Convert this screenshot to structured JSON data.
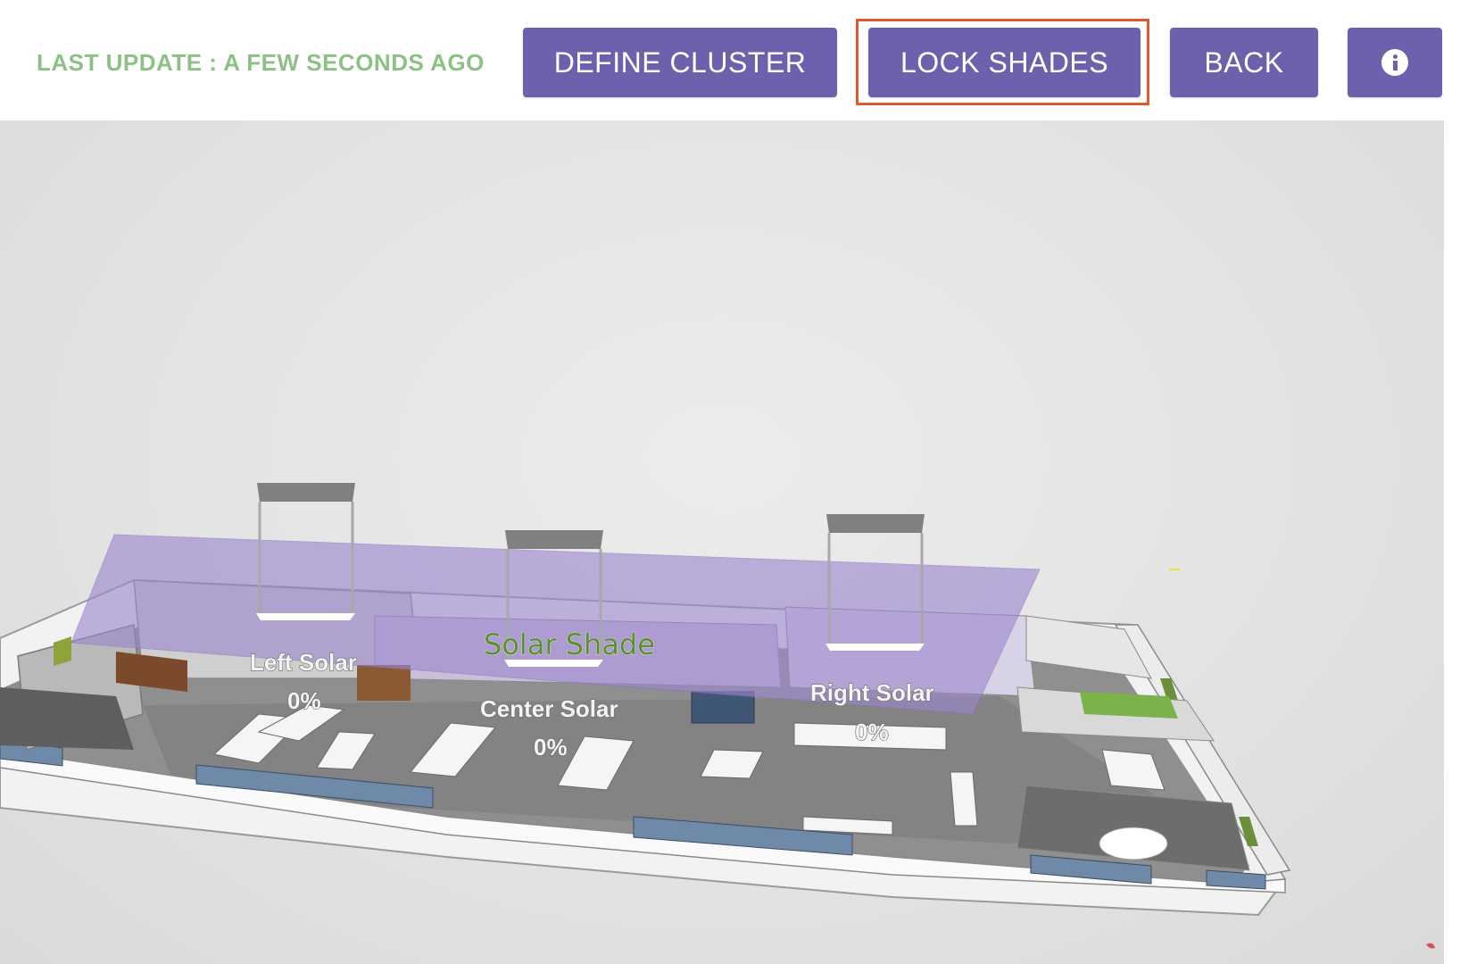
{
  "header": {
    "last_update": "LAST UPDATE : A FEW SECONDS AGO",
    "buttons": {
      "define_cluster": "DEFINE CLUSTER",
      "lock_shades": "LOCK SHADES",
      "back": "BACK"
    },
    "info_icon": "info-circle-icon"
  },
  "scene": {
    "shade_plane_label": "Solar Shade",
    "zones": [
      {
        "name": "Left Solar",
        "value": "0%"
      },
      {
        "name": "Center Solar",
        "value": "0%"
      },
      {
        "name": "Right Solar",
        "value": "0%"
      }
    ]
  },
  "colors": {
    "accent": "#6e60ac",
    "status_text": "#8cc084",
    "highlight": "#e0592e",
    "shade_plane": "#9d87cf"
  }
}
